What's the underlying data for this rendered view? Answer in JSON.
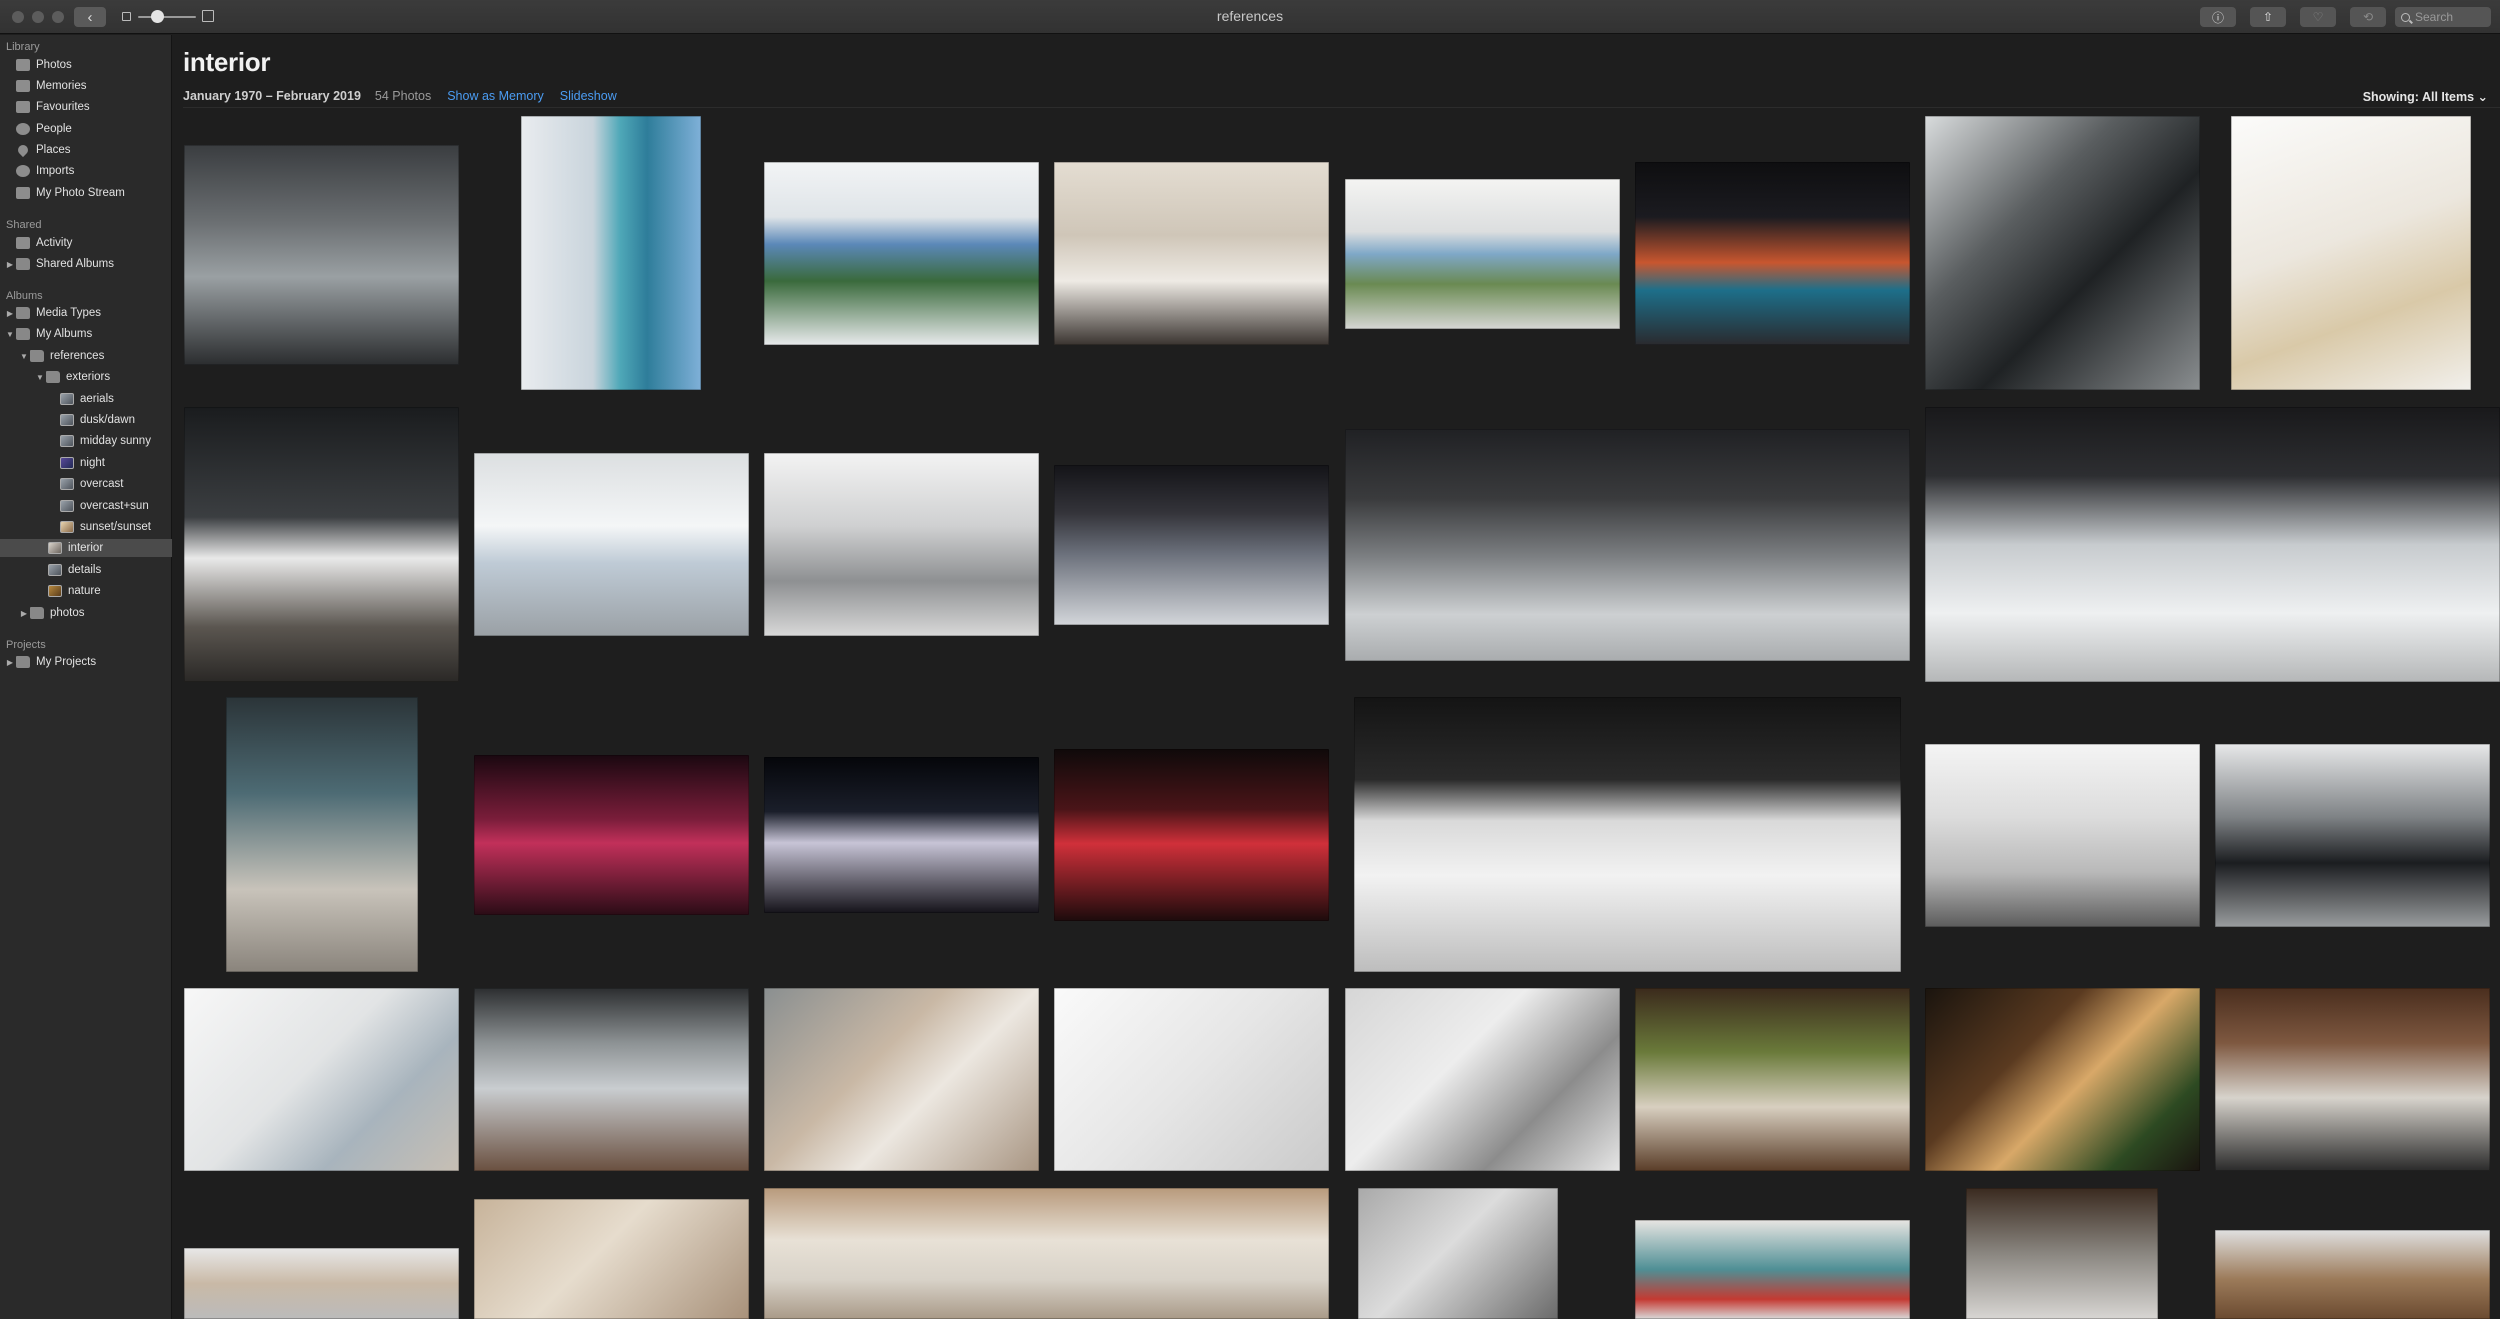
{
  "window": {
    "title": "references"
  },
  "toolbar": {
    "search_placeholder": "Search"
  },
  "sidebar": {
    "sections": [
      {
        "key": "library",
        "label": "Library"
      },
      {
        "key": "shared",
        "label": "Shared"
      },
      {
        "key": "albums",
        "label": "Albums"
      },
      {
        "key": "projects",
        "label": "Projects"
      }
    ],
    "items": [
      {
        "label": "Photos",
        "icon": "photos-icon",
        "selected": false
      },
      {
        "label": "Memories",
        "icon": "memories-icon",
        "selected": false
      },
      {
        "label": "Favourites",
        "icon": "heart-icon",
        "selected": false
      },
      {
        "label": "People",
        "icon": "people-icon",
        "selected": false
      },
      {
        "label": "Places",
        "icon": "pin-icon",
        "selected": false
      },
      {
        "label": "Imports",
        "icon": "clock-icon",
        "selected": false
      },
      {
        "label": "My Photo Stream",
        "icon": "cloud-icon",
        "selected": false
      },
      {
        "label": "Activity",
        "icon": "cloud-icon",
        "selected": false
      },
      {
        "label": "Shared Albums",
        "icon": "folder-icon",
        "selected": false
      },
      {
        "label": "Media Types",
        "icon": "folder-icon",
        "selected": false
      },
      {
        "label": "My Albums",
        "icon": "folder-icon",
        "selected": false
      },
      {
        "label": "references",
        "icon": "folder-icon",
        "selected": false
      },
      {
        "label": "exteriors",
        "icon": "folder-icon",
        "selected": false
      },
      {
        "label": "aerials",
        "icon": "album-thumb-icon",
        "selected": false
      },
      {
        "label": "dusk/dawn",
        "icon": "album-thumb-icon",
        "selected": false
      },
      {
        "label": "midday sunny",
        "icon": "album-thumb-icon",
        "selected": false
      },
      {
        "label": "night",
        "icon": "album-thumb-icon",
        "selected": false
      },
      {
        "label": "overcast",
        "icon": "album-thumb-icon",
        "selected": false
      },
      {
        "label": "overcast+sun",
        "icon": "album-thumb-icon",
        "selected": false
      },
      {
        "label": "sunset/sunset",
        "icon": "album-thumb-icon",
        "selected": false
      },
      {
        "label": "interior",
        "icon": "album-thumb-icon",
        "selected": true
      },
      {
        "label": "details",
        "icon": "album-thumb-icon",
        "selected": false
      },
      {
        "label": "nature",
        "icon": "album-thumb-icon",
        "selected": false
      },
      {
        "label": "photos",
        "icon": "folder-icon",
        "selected": false
      },
      {
        "label": "My Projects",
        "icon": "folder-icon",
        "selected": false
      }
    ]
  },
  "album": {
    "title": "interior",
    "date_range": "January 1970 – February 2019",
    "count": "54 Photos",
    "show_memory": "Show as Memory",
    "slideshow": "Slideshow",
    "showing": "Showing: All Items ⌄"
  },
  "colors": {
    "accent": "#4b9cf2",
    "sidebar_bg": "#2a2a2a",
    "content_bg": "#1e1e1e",
    "selected_row": "#4b4b4b"
  }
}
